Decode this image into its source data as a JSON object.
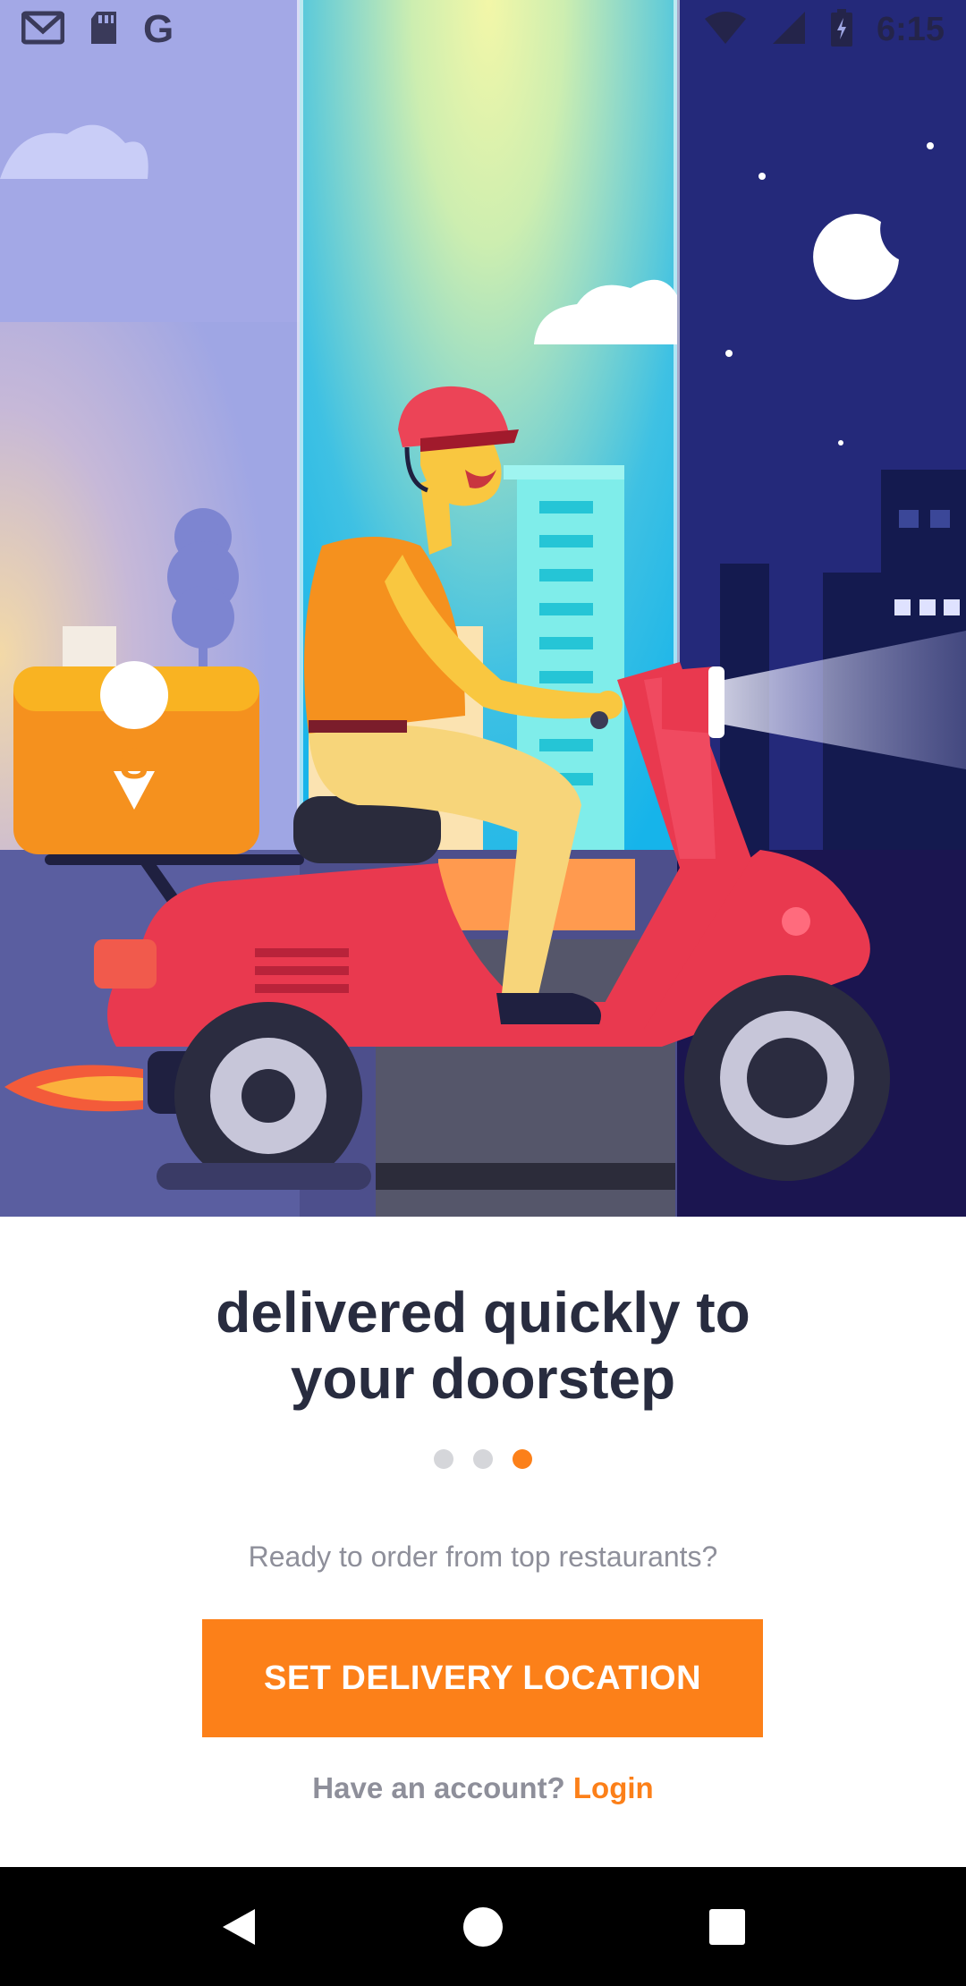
{
  "status_bar": {
    "time": "6:15",
    "left_icons": [
      "gmail-icon",
      "sd-card-icon",
      "google-icon"
    ],
    "right_icons": [
      "wifi-icon",
      "signal-icon",
      "battery-icon"
    ]
  },
  "onboarding": {
    "headline_line1": "delivered quickly to",
    "headline_line2": "your doorstep",
    "page_indicator": {
      "total": 3,
      "active": 3
    },
    "prompt": "Ready to order from top restaurants?",
    "cta_label": "SET DELIVERY LOCATION",
    "login_prefix": "Have an account?",
    "login_link": "Login"
  },
  "nav_bar": {
    "buttons": [
      "back-icon",
      "home-icon",
      "recents-icon"
    ]
  },
  "colors": {
    "accent": "#fc8019",
    "headline": "#282c3f",
    "muted": "#8e8f9a"
  }
}
